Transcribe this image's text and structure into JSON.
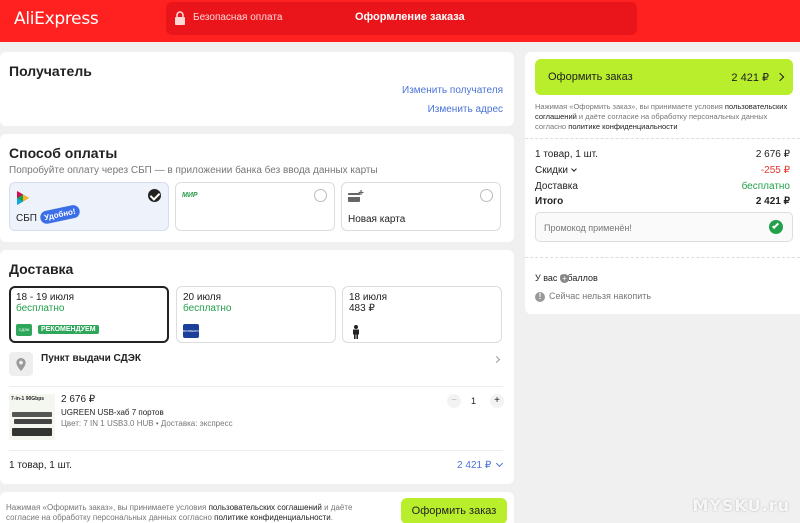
{
  "header": {
    "logo": "AliExpress",
    "secure_payment": "Безопасная оплата",
    "title": "Оформление заказа"
  },
  "recipient": {
    "title": "Получатель",
    "change_recipient": "Изменить получателя",
    "change_address": "Изменить адрес"
  },
  "payment": {
    "title": "Способ оплаты",
    "hint": "Попробуйте оплату через СБП — в приложении банка без ввода данных карты",
    "options": [
      {
        "label": "СБП",
        "badge": "Удобно!",
        "selected": true
      },
      {
        "label": "",
        "logo": "МИР",
        "selected": false
      },
      {
        "label": "Новая карта",
        "selected": false
      }
    ]
  },
  "delivery": {
    "title": "Доставка",
    "options": [
      {
        "dates": "18 - 19 июля",
        "price": "бесплатно",
        "carrier": "СДЭК",
        "badge": "РЕКОМЕНДУЕМ",
        "selected": true
      },
      {
        "dates": "20 июля",
        "price": "бесплатно",
        "carrier": "BOXBERRY"
      },
      {
        "dates": "18 июля",
        "price": "483 ₽",
        "carrier": "courier"
      }
    ],
    "pickup": "Пункт выдачи СДЭК",
    "product": {
      "image_label": "7-in-1 90Gbps",
      "price": "2 676 ₽",
      "name": "UGREEN USB-хаб 7 портов",
      "variant": "Цвет: 7 IN 1 USB3.0 HUB • Доставка: экспресс",
      "qty": "1"
    },
    "summary_count": "1 товар, 1 шт.",
    "summary_total": "2 421 ₽"
  },
  "footer": {
    "consent_pre": "Нажимая «Оформить заказ», вы принимаете условия ",
    "consent_link1": "пользовательских соглашений",
    "consent_mid": " и даёте согласие на обработку персональных данных согласно ",
    "consent_link2": "политике конфиденциальности",
    "consent_end": ".",
    "button": "Оформить заказ"
  },
  "sidebar": {
    "button_label": "Оформить заказ",
    "button_total": "2 421 ₽",
    "consent_pre": "Нажимая «Оформить заказ», вы принимаете условия ",
    "consent_link1": "пользовательских соглашений",
    "consent_mid": " и даёте согласие на обработку персональных данных согласно ",
    "consent_link2": "политике конфиденциальности",
    "consent_end": "",
    "lines": [
      {
        "label": "1 товар, 1 шт.",
        "value": "2 676 ₽"
      },
      {
        "label": "Скидки",
        "value": "-255 ₽"
      },
      {
        "label": "Доставка",
        "value": "бесплатно"
      },
      {
        "label": "Итого",
        "value": "2 421 ₽"
      }
    ],
    "promo": "Промокод применён!",
    "points": "У вас  0 баллов",
    "points_note": "Сейчас нельзя накопить"
  },
  "watermark": "MYSKU.ru",
  "colors": {
    "brand_red": "#ff2020",
    "accent_green": "#b8ee2c",
    "link_blue": "#4a72d8",
    "success_green": "#22a04b"
  }
}
